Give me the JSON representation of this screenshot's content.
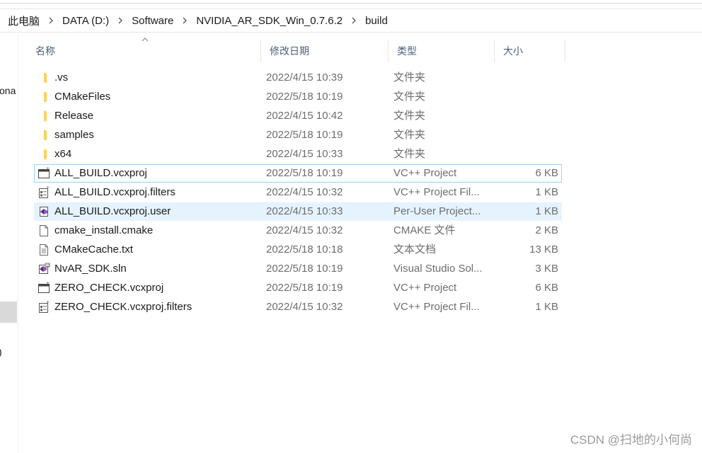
{
  "breadcrumb": [
    "此电脑",
    "DATA (D:)",
    "Software",
    "NVIDIA_AR_SDK_Win_0.7.6.2",
    "build"
  ],
  "nav": {
    "partial_label": "ona",
    "partial_paren": ")"
  },
  "columns": {
    "name": "名称",
    "date": "修改日期",
    "type": "类型",
    "size": "大小"
  },
  "files": [
    {
      "name": ".vs",
      "date": "2022/4/15 10:39",
      "type": "文件夹",
      "size": "",
      "icon": "folder-icon"
    },
    {
      "name": "CMakeFiles",
      "date": "2022/5/18 10:19",
      "type": "文件夹",
      "size": "",
      "icon": "folder-icon"
    },
    {
      "name": "Release",
      "date": "2022/4/15 10:42",
      "type": "文件夹",
      "size": "",
      "icon": "folder-icon"
    },
    {
      "name": "samples",
      "date": "2022/5/18 10:19",
      "type": "文件夹",
      "size": "",
      "icon": "folder-icon"
    },
    {
      "name": "x64",
      "date": "2022/4/15 10:33",
      "type": "文件夹",
      "size": "",
      "icon": "folder-icon"
    },
    {
      "name": "ALL_BUILD.vcxproj",
      "date": "2022/5/18 10:19",
      "type": "VC++ Project",
      "size": "6 KB",
      "icon": "vcxproj-icon",
      "state": "focused"
    },
    {
      "name": "ALL_BUILD.vcxproj.filters",
      "date": "2022/4/15 10:32",
      "type": "VC++ Project Fil...",
      "size": "1 KB",
      "icon": "vcxproj-filters-icon"
    },
    {
      "name": "ALL_BUILD.vcxproj.user",
      "date": "2022/4/15 10:33",
      "type": "Per-User Project...",
      "size": "1 KB",
      "icon": "vs-user-icon",
      "state": "selected"
    },
    {
      "name": "cmake_install.cmake",
      "date": "2022/4/15 10:32",
      "type": "CMAKE 文件",
      "size": "2 KB",
      "icon": "blank-file-icon"
    },
    {
      "name": "CMakeCache.txt",
      "date": "2022/5/18 10:18",
      "type": "文本文档",
      "size": "13 KB",
      "icon": "text-file-icon"
    },
    {
      "name": "NvAR_SDK.sln",
      "date": "2022/5/18 10:19",
      "type": "Visual Studio Sol...",
      "size": "3 KB",
      "icon": "vs-solution-icon"
    },
    {
      "name": "ZERO_CHECK.vcxproj",
      "date": "2022/5/18 10:19",
      "type": "VC++ Project",
      "size": "6 KB",
      "icon": "vcxproj-icon"
    },
    {
      "name": "ZERO_CHECK.vcxproj.filters",
      "date": "2022/4/15 10:32",
      "type": "VC++ Project Fil...",
      "size": "1 KB",
      "icon": "vcxproj-filters-icon"
    }
  ],
  "watermark": "CSDN @扫地的小何尚",
  "colors": {
    "selected_bg": "#e5f3ff",
    "focus_border": "#99d1ff",
    "folder": "#ffd25a",
    "header_text": "#4c607a",
    "vs_purple": "#68217a"
  }
}
